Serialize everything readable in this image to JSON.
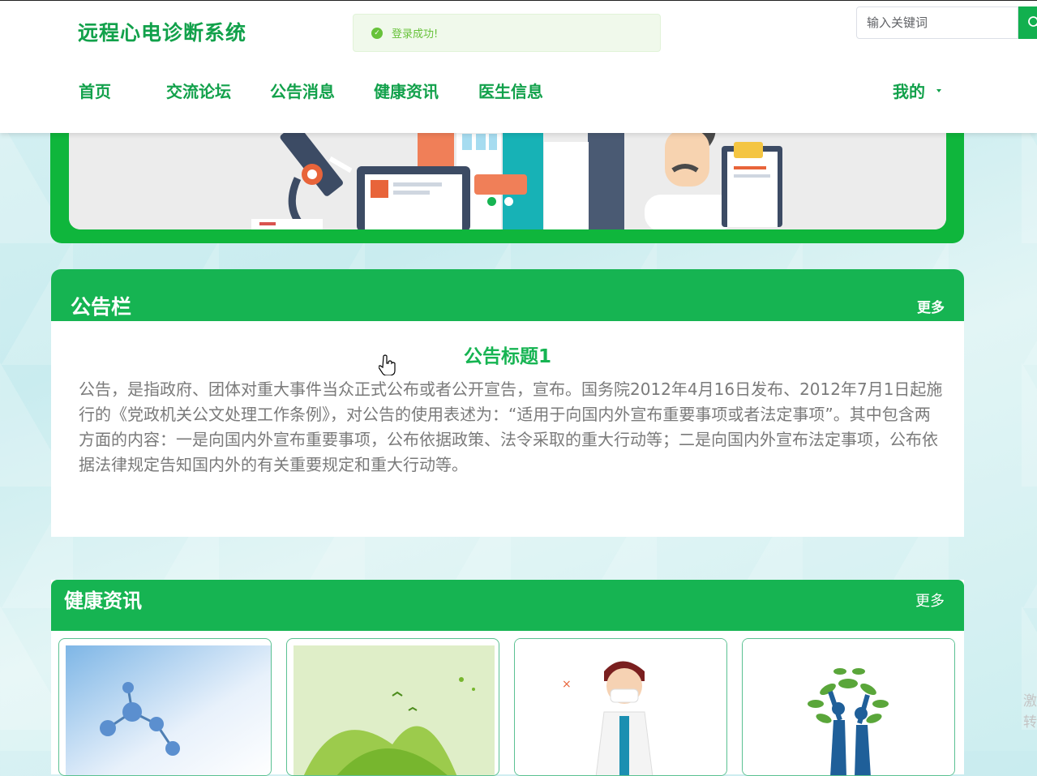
{
  "header": {
    "site_title": "远程心电诊断系统",
    "toast": "登录成功!",
    "search_placeholder": "输入关键词"
  },
  "nav": {
    "items": [
      "首页",
      "交流论坛",
      "公告消息",
      "健康资讯",
      "医生信息"
    ],
    "user_menu": "我的"
  },
  "notice_board": {
    "title": "公告栏",
    "more": "更多",
    "heading": "公告标题1",
    "body": "公告，是指政府、团体对重大事件当众正式公布或者公开宣告，宣布。国务院2012年4月16日发布、2012年7月1日起施行的《党政机关公文处理工作条例》，对公告的使用表述为：“适用于向国内外宣布重要事项或者法定事项”。其中包含两方面的内容：一是向国内外宣布重要事项，公布依据政策、法令采取的重大行动等；二是向国内外宣布法定事项，公布依据法律规定告知国内外的有关重要规定和重大行动等。"
  },
  "health_news": {
    "title": "健康资讯",
    "more": "更多"
  },
  "edge_text": [
    "激",
    "转"
  ],
  "colors": {
    "brand": "#16b452",
    "success_text": "#67c23a"
  },
  "banner": {
    "active_slide": 1,
    "slide_count": 2
  }
}
